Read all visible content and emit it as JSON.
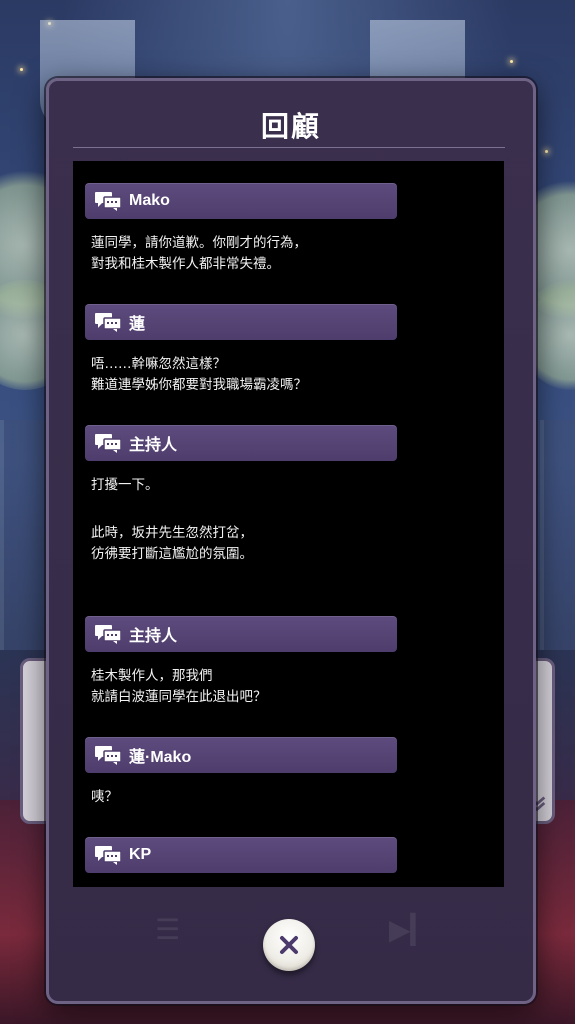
{
  "dialog": {
    "title": "回顧"
  },
  "log": [
    {
      "speaker": "Mako",
      "lines": [
        "蓮同學，請你道歉。你剛才的行為，",
        "對我和桂木製作人都非常失禮。"
      ]
    },
    {
      "speaker": "蓮",
      "lines": [
        "唔……幹嘛忽然這樣？",
        "難道連學姊你都要對我職場霸凌嗎？"
      ]
    },
    {
      "speaker": "主持人",
      "lines": [
        "打擾一下。"
      ]
    },
    {
      "speaker": null,
      "lines": [
        "此時，坂井先生忽然打岔，",
        "彷彿要打斷這尷尬的氛圍。"
      ]
    },
    {
      "speaker": "主持人",
      "lines": [
        "桂木製作人，那我們",
        "就請白波蓮同學在此退出吧？"
      ]
    },
    {
      "speaker": "蓮·Mako",
      "lines": [
        "咦？"
      ]
    },
    {
      "speaker": "KP",
      "lines": []
    }
  ],
  "icons": {
    "speaker": "chat-bubbles-icon",
    "close": "close-icon",
    "scroll": "chevron-down-icon"
  },
  "colors": {
    "panel": "#3a2f4d",
    "speaker_bar": "#5e4b7e",
    "log_bg": "#000000"
  }
}
